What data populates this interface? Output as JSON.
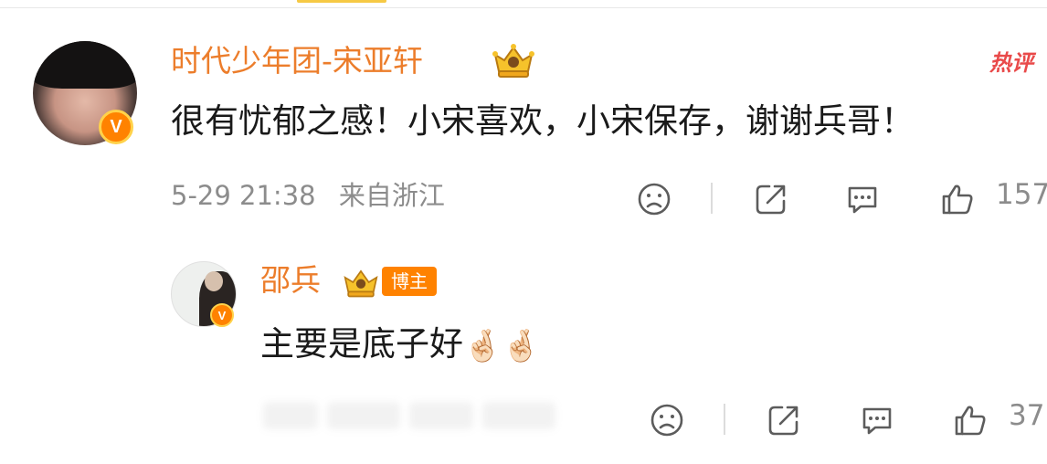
{
  "comment": {
    "username": "时代少年团-宋亚轩",
    "hot_label": "热评",
    "text": "很有忧郁之感！小宋喜欢，小宋保存，谢谢兵哥！",
    "date": "5-29 21:38",
    "location": "来自浙江",
    "like_count": "157"
  },
  "reply": {
    "username": "邵兵",
    "owner_tag": "博主",
    "text": "主要是底子好",
    "emojis": "🤞🏻🤞🏻",
    "like_count": "37"
  },
  "colors": {
    "username": "#ec7d2b",
    "badge_orange": "#ff8200",
    "hot_red": "#e94a4a",
    "meta_gray": "#8c8c8c",
    "icon_gray": "#5c5c5c"
  },
  "icons": {
    "dislike": "sad-face-icon",
    "share": "share-icon",
    "reply": "comment-icon",
    "like": "thumbs-up-icon",
    "verified": "verified-v-badge-icon",
    "vip": "crown-badge-icon"
  }
}
